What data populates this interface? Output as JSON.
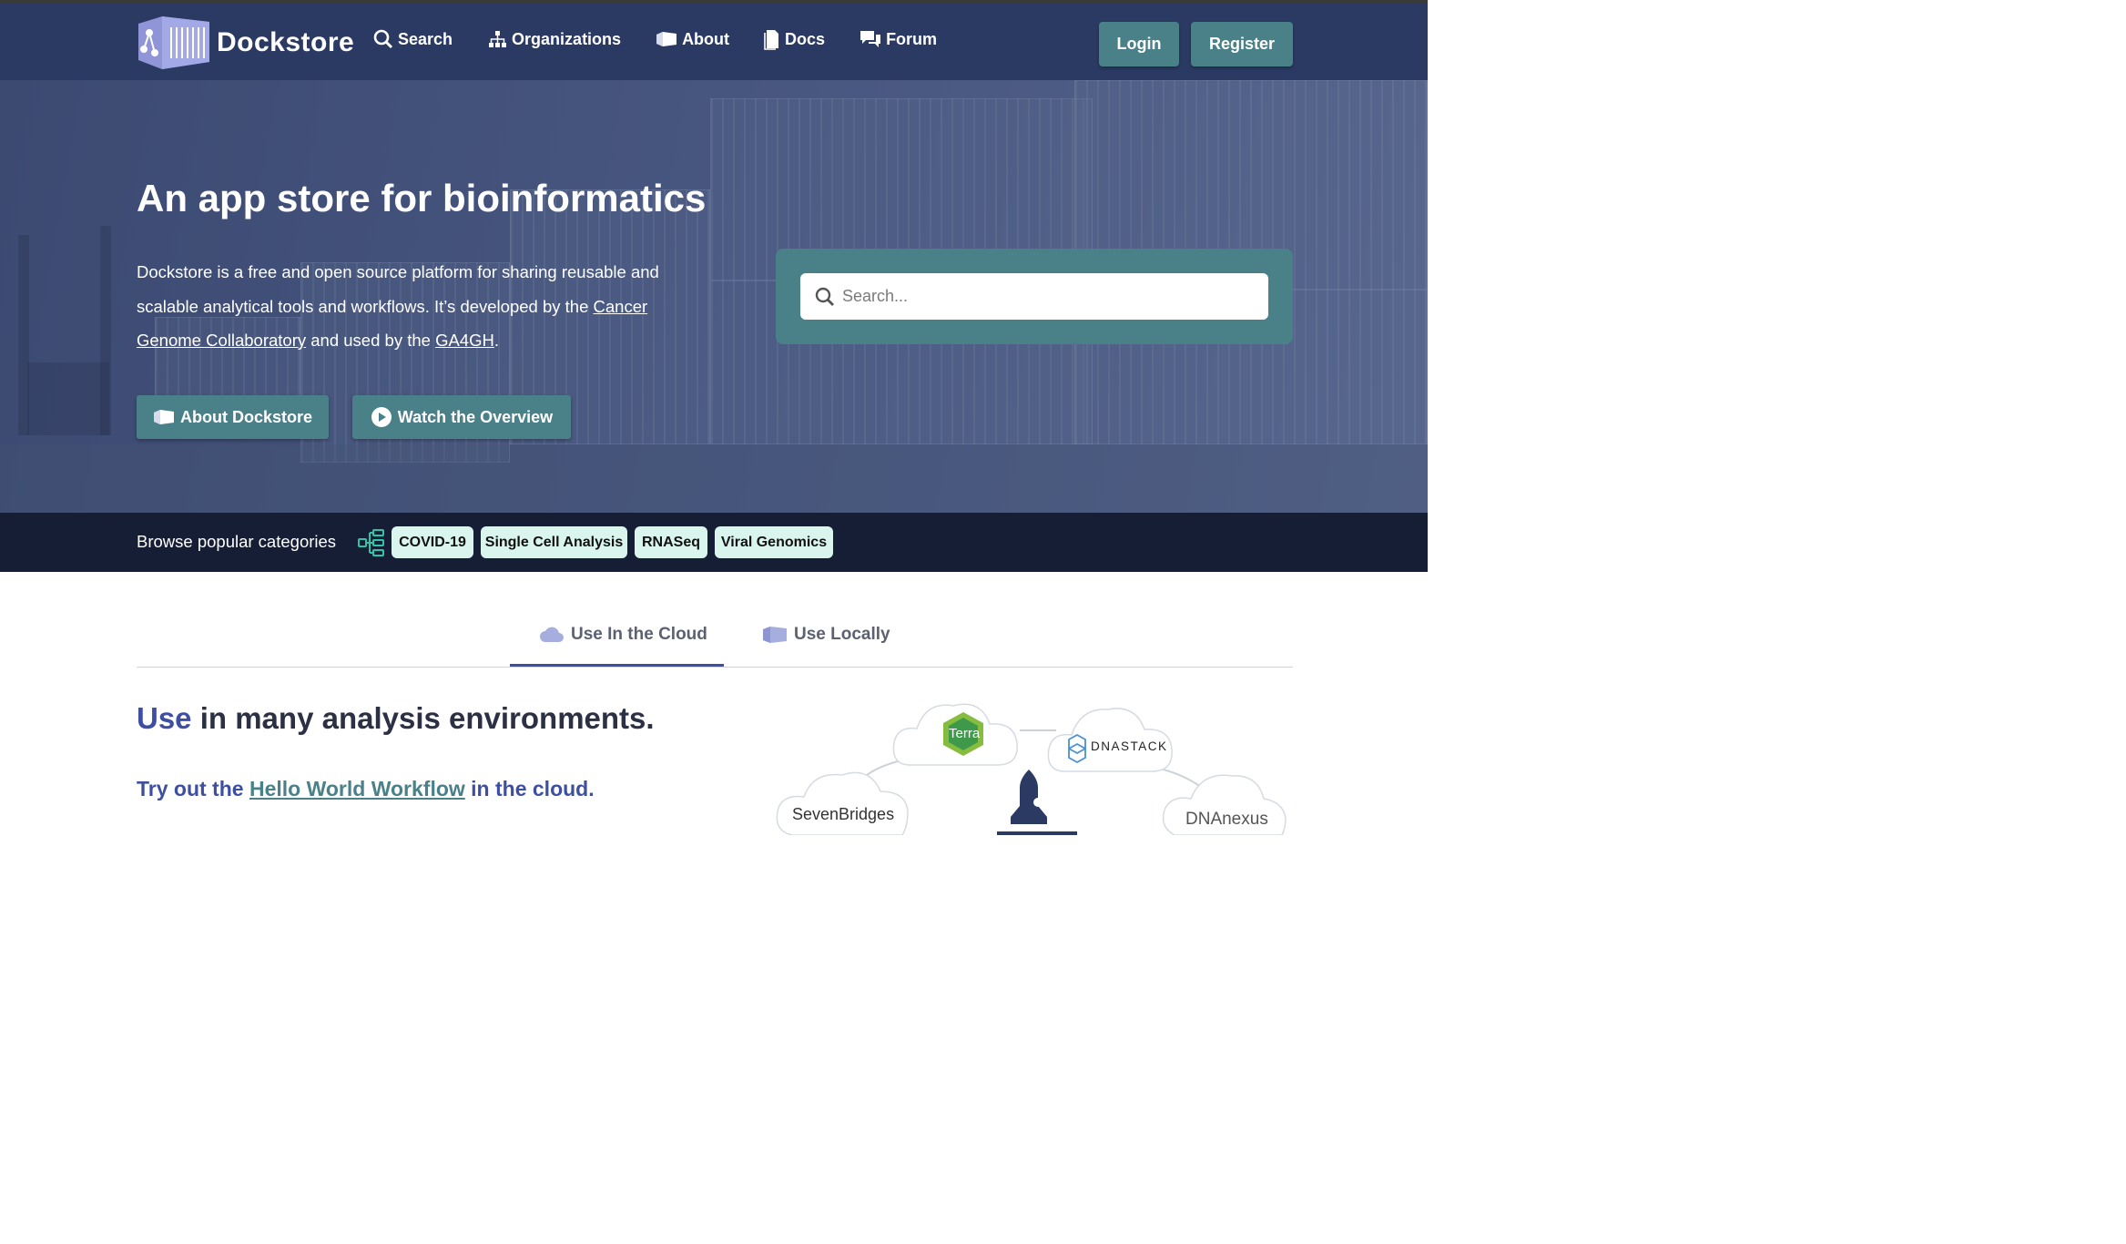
{
  "nav": {
    "logo_text": "Dockstore",
    "items": [
      {
        "label": "Search",
        "icon": "search-icon"
      },
      {
        "label": "Organizations",
        "icon": "organizations-icon"
      },
      {
        "label": "About",
        "icon": "about-box-icon"
      },
      {
        "label": "Docs",
        "icon": "docs-icon"
      },
      {
        "label": "Forum",
        "icon": "forum-icon"
      }
    ],
    "login_label": "Login",
    "register_label": "Register"
  },
  "hero": {
    "title": "An app store for bioinformatics",
    "desc_part1": "Dockstore is a free and open source platform for sharing reusable and scalable analytical tools and workflows. It’s developed by the ",
    "link_cancer": "Cancer Genome Collaboratory",
    "desc_part2": " and used by the ",
    "link_ga4gh": "GA4GH",
    "desc_part3": ".",
    "about_button": "About Dockstore",
    "overview_button": "Watch the Overview",
    "search_placeholder": "Search..."
  },
  "categories": {
    "label": "Browse popular categories",
    "chips": [
      "COVID-19",
      "Single Cell Analysis",
      "RNASeq",
      "Viral Genomics"
    ]
  },
  "tabs": [
    {
      "label": "Use In the Cloud",
      "active": true
    },
    {
      "label": "Use Locally",
      "active": false
    }
  ],
  "main": {
    "heading_highlight": "Use",
    "heading_rest": " in many analysis environments.",
    "try_prefix": "Try out the ",
    "try_link": "Hello World Workflow",
    "try_suffix": " in the cloud."
  },
  "platforms": {
    "terra": "Terra",
    "dnastack": "DNASTACK",
    "sevenbridges": "SevenBridges",
    "dnanexus": "DNAnexus"
  },
  "colors": {
    "nav_bg": "#2b3a62",
    "accent_teal": "#4a8189",
    "category_bar": "#151e35",
    "chip_bg": "#d9f5ee",
    "primary_blue": "#3e4fa1"
  }
}
